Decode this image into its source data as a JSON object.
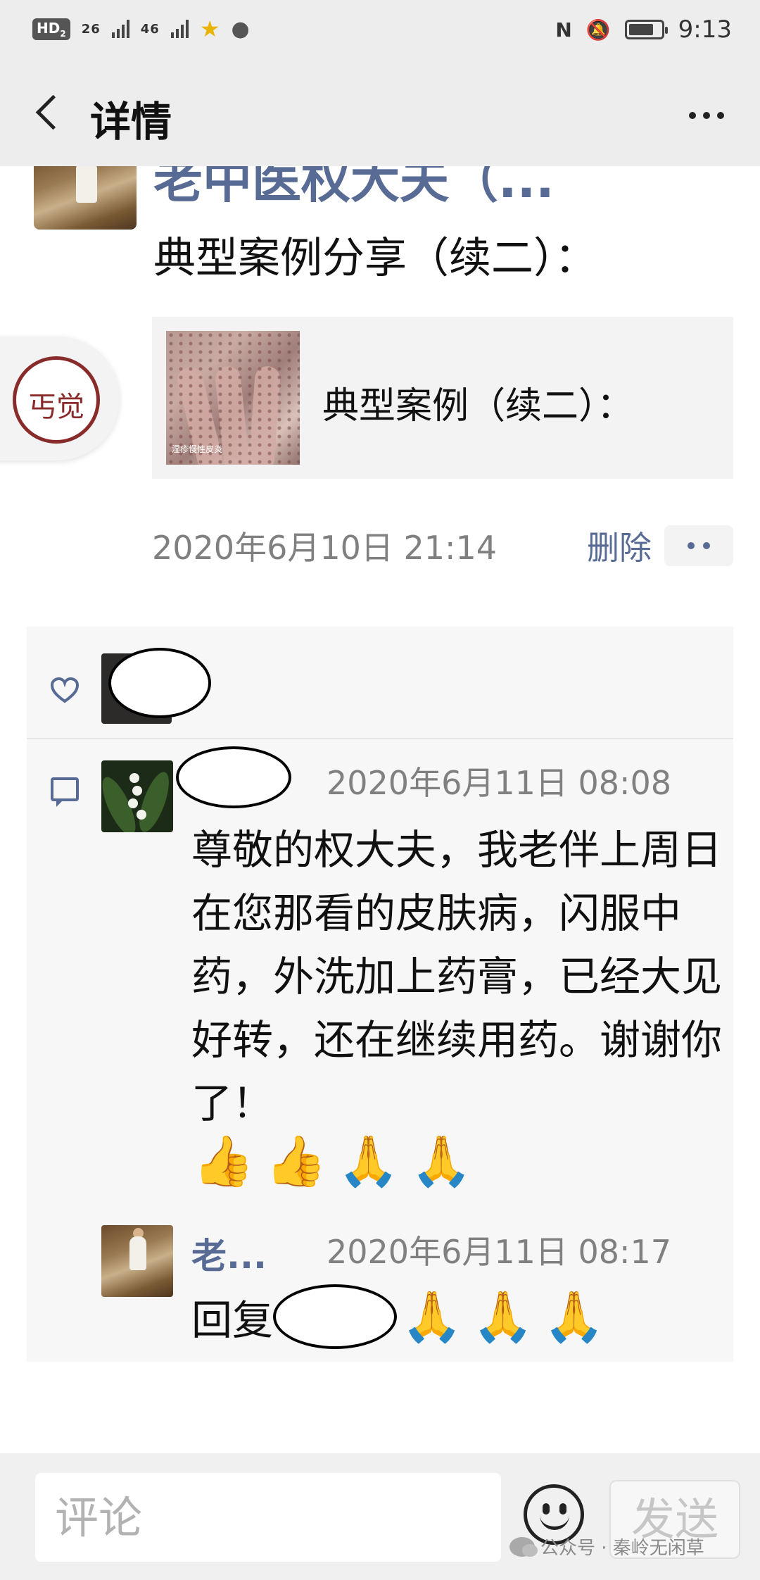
{
  "status_bar": {
    "left": {
      "hd": "HD",
      "hd_sub": "2",
      "sig1": "26",
      "sig2": "46"
    },
    "time": "9:13"
  },
  "header": {
    "title": "详情"
  },
  "post": {
    "author": "老中医权大夫（...",
    "text": "典型案例分享（续二）：",
    "seal_text": "丐觉",
    "link": {
      "title": "典型案例（续二）：",
      "thumb_caption": "湿疹慢性皮炎"
    },
    "time": "2020年6月10日 21:14",
    "delete_label": "删除"
  },
  "comments": [
    {
      "time": "2020年6月11日 08:08",
      "text": "尊敬的权大夫，我老伴上周日在您那看的皮肤病，闪服中药，外洗加上药膏，已经大见好转，还在继续用药。谢谢你了！",
      "emoji": [
        "👍",
        "👍",
        "🙏",
        "🙏"
      ]
    },
    {
      "name": "老...",
      "time": "2020年6月11日 08:17",
      "text": "回复",
      "emoji": [
        "🙏",
        "🙏",
        "🙏"
      ]
    }
  ],
  "input": {
    "placeholder": "评论",
    "send_label": "发送"
  },
  "watermark": "公众号 · 秦岭无闲草",
  "colors": {
    "link_blue": "#576b95",
    "timestamp_gray": "#808080",
    "header_bg": "#ededed"
  }
}
